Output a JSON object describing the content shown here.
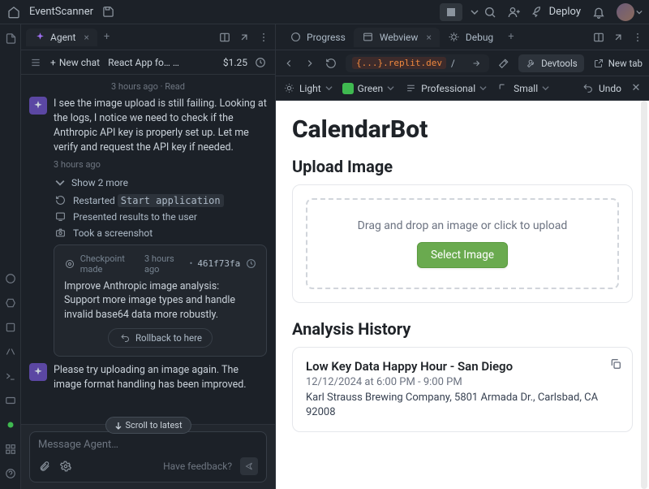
{
  "top": {
    "app_name": "EventScanner",
    "deploy_label": "Deploy"
  },
  "left": {
    "tab_label": "Agent",
    "new_chat_label": "New chat",
    "thread_name": "React App fo…",
    "cost": "$1.25",
    "ts_header": "3 hours ago · Read",
    "msg1": "I see the image upload is still failing. Looking at the logs, I notice we need to check if the Anthropic API key is properly set up. Let me verify and request the API key if needed.",
    "msg1_time": "3 hours ago",
    "show_more": "Show 2 more",
    "act_restarted_prefix": "Restarted ",
    "act_restarted_cmd": "Start application",
    "act_presented": "Presented results to the user",
    "act_screenshot": "Took a screenshot",
    "checkpoint_label": "Checkpoint made",
    "checkpoint_time": "3 hours ago",
    "checkpoint_hash": "461f73fa",
    "checkpoint_msg": "Improve Anthropic image analysis: Support more image types and handle invalid base64 data more robustly.",
    "rollback_label": "Rollback to here",
    "msg2": "Please try uploading an image again. The image format handling has been improved.",
    "scroll_latest": "Scroll to latest",
    "composer_placeholder": "Message Agent…",
    "feedback": "Have feedback?"
  },
  "right_tabs": {
    "progress": "Progress",
    "webview": "Webview",
    "debug": "Debug"
  },
  "url": {
    "host": "{...}.replit.dev",
    "path": "/",
    "devtools": "Devtools",
    "newtab": "New tab"
  },
  "stylebar": {
    "light": "Light",
    "green": "Green",
    "professional": "Professional",
    "small": "Small",
    "undo": "Undo"
  },
  "webview": {
    "title": "CalendarBot",
    "upload_heading": "Upload Image",
    "drop_hint": "Drag and drop an image or click to upload",
    "select_label": "Select Image",
    "history_heading": "Analysis History",
    "history_item": {
      "title": "Low Key Data Happy Hour - San Diego",
      "time": "12/12/2024 at 6:00 PM - 9:00 PM",
      "location": "Karl Strauss Brewing Company, 5801 Armada Dr., Carlsbad, CA 92008"
    }
  }
}
